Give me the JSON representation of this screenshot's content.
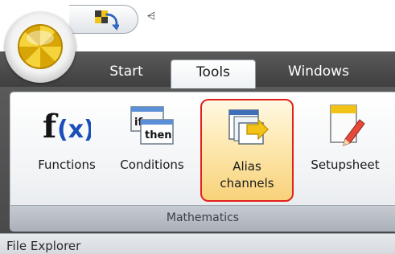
{
  "quick_access": {
    "app_button_icon": "app-orb-icon",
    "buttons": [
      {
        "icon": "run-icon"
      }
    ],
    "customize_glyph": "⩤"
  },
  "tabs": [
    {
      "label": "Start",
      "selected": false
    },
    {
      "label": "Tools",
      "selected": true
    },
    {
      "label": "Windows",
      "selected": false
    }
  ],
  "ribbon": {
    "group": {
      "caption": "Mathematics",
      "items": [
        {
          "icon": "functions-icon",
          "label_lines": [
            "Functions"
          ]
        },
        {
          "icon": "conditions-icon",
          "label_lines": [
            "Conditions"
          ],
          "icon_text": [
            "if",
            "then"
          ]
        },
        {
          "icon": "alias-channels-icon",
          "label_lines": [
            "Alias",
            "channels"
          ],
          "highlighted": true
        },
        {
          "icon": "setupsheet-icon",
          "label_lines": [
            "Setupsheet"
          ]
        }
      ]
    }
  },
  "panel": {
    "title": "File Explorer"
  },
  "colors": {
    "highlight_border": "#e2201c",
    "tab_bar": "#474747",
    "functions_blue": "#1b4fb8",
    "functions_black": "#151515"
  }
}
